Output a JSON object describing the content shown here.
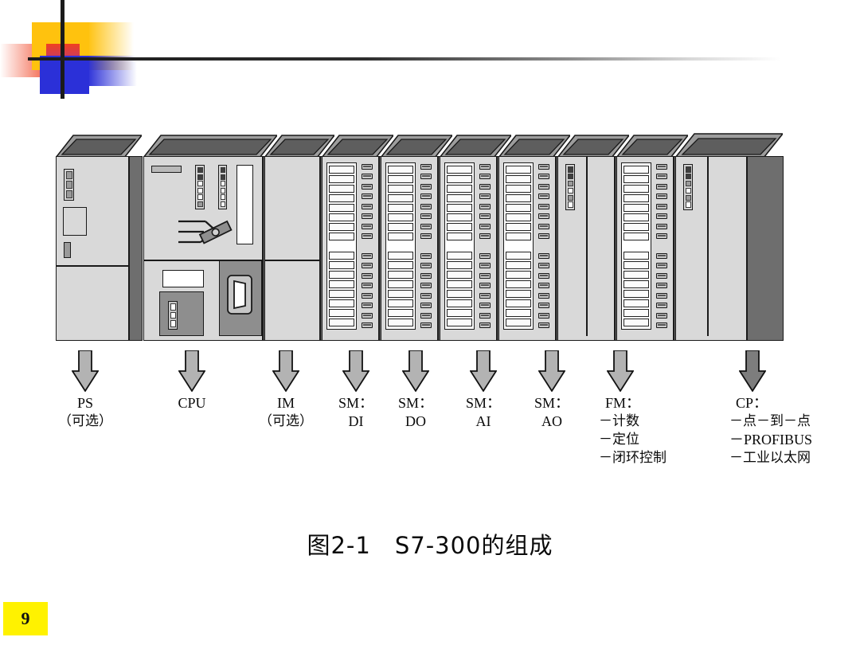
{
  "slide": {
    "page_number": "9",
    "caption": "图2-1　S7-300的组成"
  },
  "decoration": {
    "colors": {
      "yellow": "#FFC20E",
      "red": "#F04020",
      "blue": "#2B30D8",
      "rule": "#1b1b1b",
      "page_badge": "#FFF200"
    }
  },
  "diagram": {
    "title": "S7-300 rack composition",
    "modules": [
      {
        "id": "ps",
        "type": "power-supply",
        "label": "PS",
        "sub": "（可选）"
      },
      {
        "id": "cpu",
        "type": "cpu",
        "label": "CPU",
        "sub": ""
      },
      {
        "id": "im",
        "type": "interface",
        "label": "IM",
        "sub": "（可选）"
      },
      {
        "id": "sm-di",
        "type": "signal",
        "label": "SM：",
        "sub": "DI"
      },
      {
        "id": "sm-do",
        "type": "signal",
        "label": "SM：",
        "sub": "DO"
      },
      {
        "id": "sm-ai",
        "type": "signal",
        "label": "SM：",
        "sub": "AI"
      },
      {
        "id": "sm-ao",
        "type": "signal",
        "label": "SM：",
        "sub": "AO"
      },
      {
        "id": "fm",
        "type": "function",
        "label": "FM：",
        "sub": ""
      },
      {
        "id": "cp",
        "type": "communication",
        "label": "CP：",
        "sub": ""
      }
    ],
    "fm_items": [
      "－计数",
      "－定位",
      "－闭环控制"
    ],
    "cp_items": [
      "－点－到－点",
      "－PROFIBUS",
      "－工业以太网"
    ],
    "arrow_fill_light": "#b3b3b3",
    "arrow_fill_dark": "#7d7d7d"
  },
  "labels": {
    "ps_line1": "PS",
    "ps_line2": "（可选）",
    "cpu_line1": "CPU",
    "cpu_line2": "",
    "im_line1": "IM",
    "im_line2": "（可选）",
    "smdi_line1": "SM：",
    "smdi_line2": "DI",
    "smdo_line1": "SM：",
    "smdo_line2": "DO",
    "smai_line1": "SM：",
    "smai_line2": "AI",
    "smao_line1": "SM：",
    "smao_line2": "AO",
    "fm_line1": "FM：",
    "fm_item1": "－计数",
    "fm_item2": "－定位",
    "fm_item3": "－闭环控制",
    "cp_line1": "CP：",
    "cp_item1": "－点－到－点",
    "cp_item2": "－PROFIBUS",
    "cp_item3": "－工业以太网"
  }
}
